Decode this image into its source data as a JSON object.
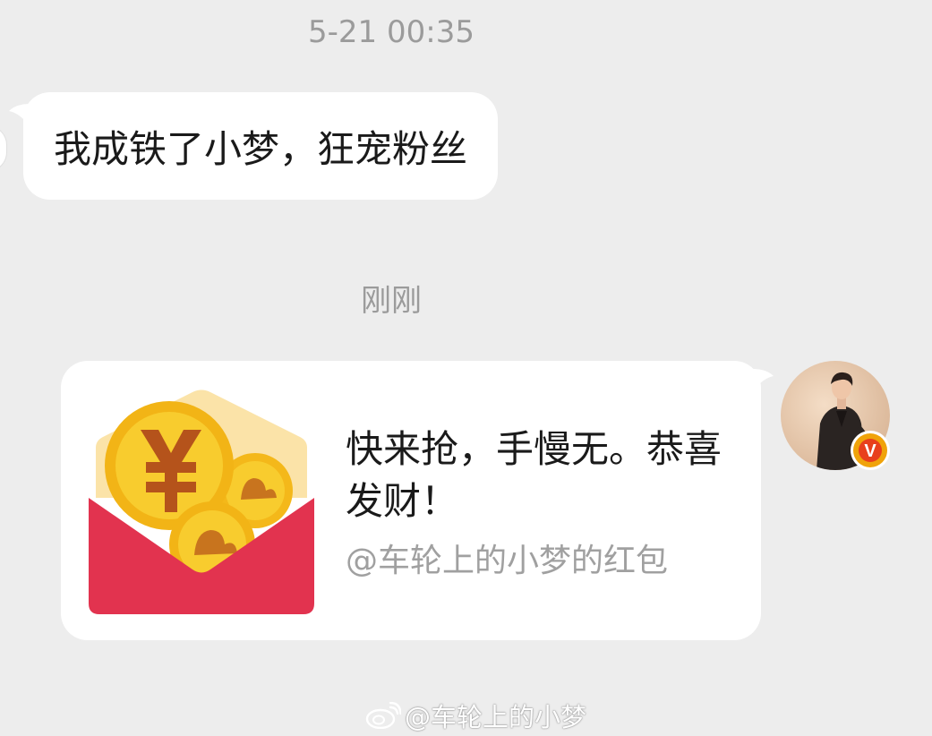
{
  "chat": {
    "timestamp_1": "5-21 00:35",
    "incoming_message": "我成铁了小梦，狂宠粉丝",
    "timestamp_2": "刚刚"
  },
  "red_packet": {
    "title": "快来抢，手慢无。恭喜发财！",
    "sender_line": "@车轮上的小梦的红包",
    "icon": "red-envelope-coin-icon",
    "colors": {
      "envelope_red": "#e2334f",
      "envelope_back": "#fbe3a8",
      "coin_gold": "#f6c21c",
      "coin_symbol": "#b5531b"
    }
  },
  "avatar": {
    "icon": "user-avatar-photo",
    "badge_letter": "V",
    "badge_color": "#f0a30a"
  },
  "watermark": {
    "logo": "weibo-logo-icon",
    "text": "@车轮上的小梦"
  },
  "colors": {
    "background": "#ededed",
    "bubble": "#ffffff",
    "timestamp_text": "#9b9b9b",
    "secondary_text": "#a0a0a0"
  }
}
